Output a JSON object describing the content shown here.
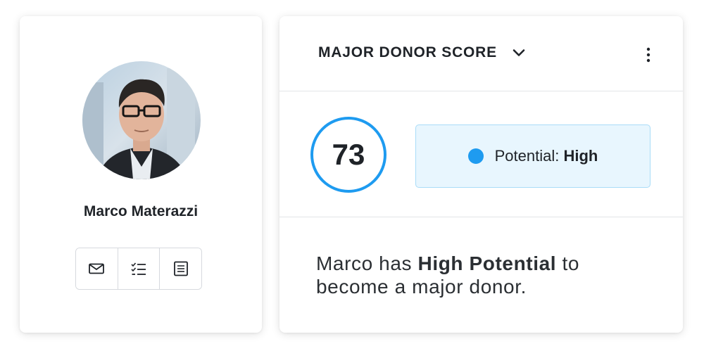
{
  "profile": {
    "name": "Marco Materazzi",
    "actions": [
      {
        "icon": "mail-icon"
      },
      {
        "icon": "checklist-icon"
      },
      {
        "icon": "notes-icon"
      }
    ]
  },
  "score_card": {
    "title": "MAJOR DONOR SCORE",
    "score": "73",
    "potential_label": "Potential:",
    "potential_value": "High",
    "summary_prefix": "Marco has",
    "summary_emphasis": "High Potential",
    "summary_suffix": "to become a major donor."
  },
  "colors": {
    "accent": "#1e9bf0",
    "potential_bg": "#e8f6fe",
    "potential_border": "#a9dcf8",
    "text": "#1f2328"
  }
}
